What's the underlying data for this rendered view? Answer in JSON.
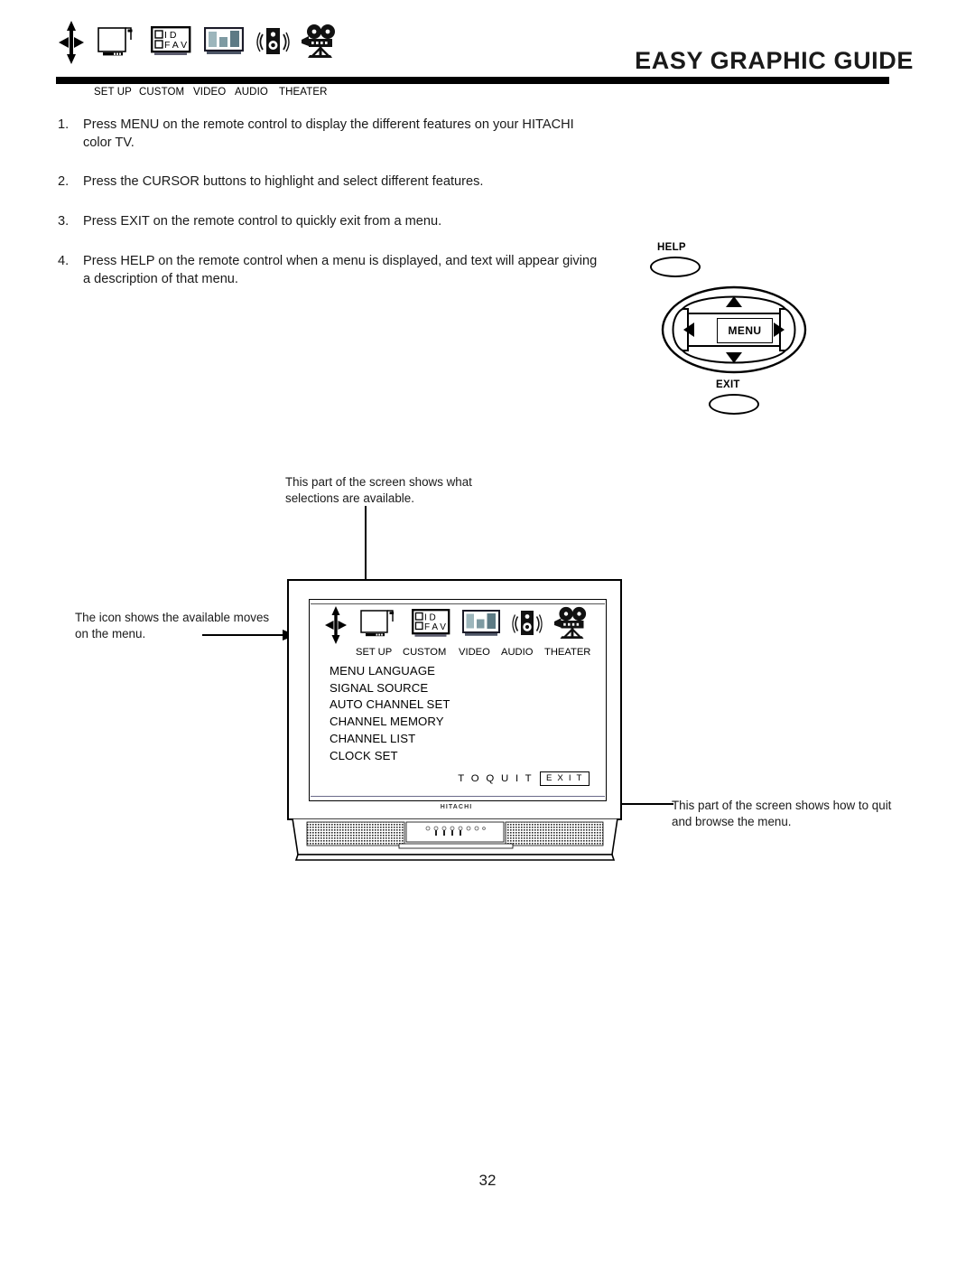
{
  "header": {
    "title": "EASY GRAPHIC GUIDE",
    "icons": [
      {
        "name": "cursor-arrows-icon",
        "label": ""
      },
      {
        "name": "set-up-icon",
        "label": "SET UP"
      },
      {
        "name": "custom-icon",
        "label": "CUSTOM"
      },
      {
        "name": "video-icon",
        "label": "VIDEO"
      },
      {
        "name": "audio-icon",
        "label": "AUDIO"
      },
      {
        "name": "theater-icon",
        "label": "THEATER"
      }
    ],
    "custom_icon_text": {
      "line1": "I D",
      "line2": "F A V"
    }
  },
  "instructions": [
    {
      "num": "1.",
      "text": "Press MENU on the remote control to display the different features on your HITACHI color TV."
    },
    {
      "num": "2.",
      "text": "Press the CURSOR buttons to highlight and select different features."
    },
    {
      "num": "3.",
      "text": "Press EXIT on the remote control to quickly exit from a menu."
    },
    {
      "num": "4.",
      "text": "Press HELP on the remote control when a menu is displayed, and text will appear giving a description of that menu."
    }
  ],
  "remote": {
    "help_label": "HELP",
    "menu_label": "MENU",
    "exit_label": "EXIT"
  },
  "callouts": {
    "top": "This part of the screen shows what selections are available.",
    "left": "The icon shows the available moves on the menu.",
    "right": "This part of the screen shows how to quit and browse the menu."
  },
  "tv": {
    "brand": "HITACHI",
    "menu_icon_labels": [
      "SET UP",
      "CUSTOM",
      "VIDEO",
      "AUDIO",
      "THEATER"
    ],
    "custom_icon_text": {
      "line1": "I D",
      "line2": "F A V"
    },
    "menu_items": [
      "MENU LANGUAGE",
      "SIGNAL SOURCE",
      "AUTO CHANNEL SET",
      "CHANNEL MEMORY",
      "CHANNEL LIST",
      "CLOCK SET"
    ],
    "quit_label": "T O   Q U I T",
    "exit_button": "E X I T"
  },
  "page_number": "32",
  "colors": {
    "ink": "#000000",
    "text": "#1a1a1a",
    "video_bar_light": "#9db6bc",
    "video_bar_mid": "#7e9aa2",
    "video_bar_dark": "#5d7a85"
  }
}
